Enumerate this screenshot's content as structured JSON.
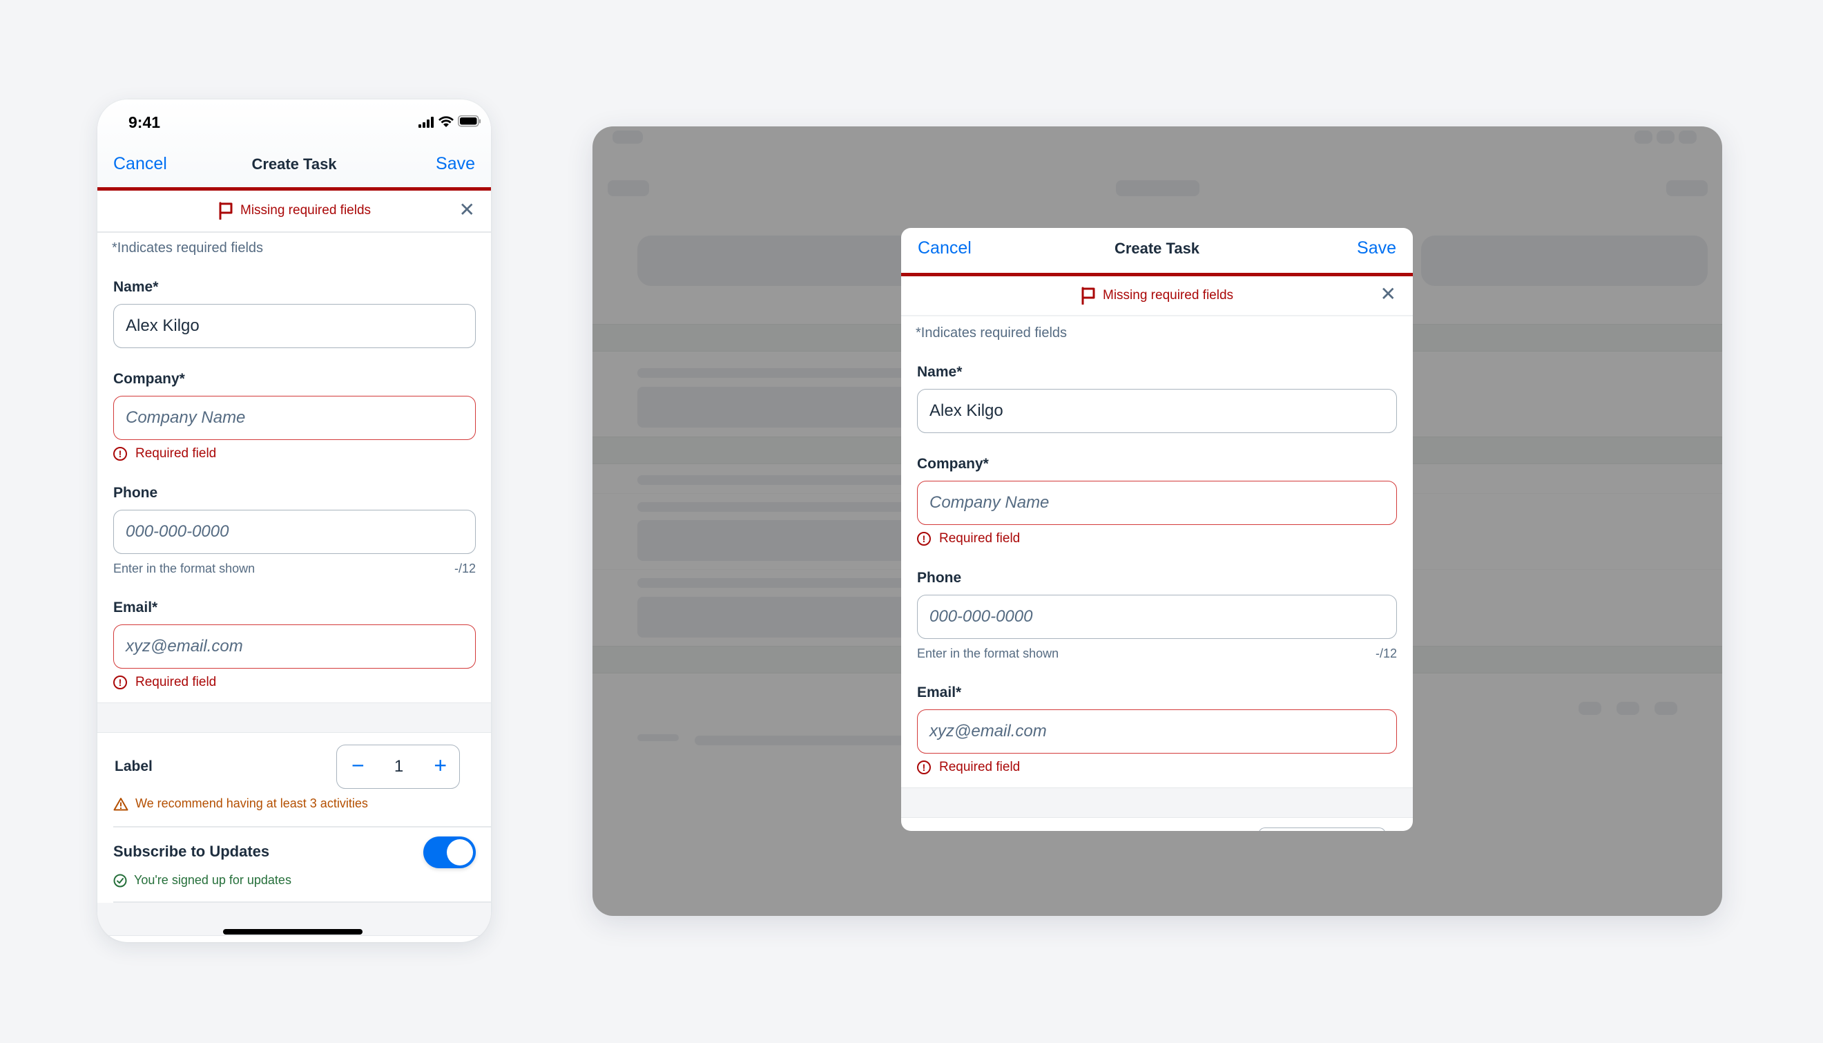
{
  "phone": {
    "status_bar": {
      "time": "9:41",
      "icons": [
        "cellular-signal-icon",
        "wifi-icon",
        "battery-icon"
      ]
    },
    "nav": {
      "cancel_label": "Cancel",
      "title": "Create Task",
      "save_label": "Save"
    },
    "banner": {
      "icon": "flag-icon",
      "message": "Missing required fields",
      "close_icon": "close-icon"
    },
    "required_hint": "*Indicates required fields",
    "fields": {
      "name": {
        "label": "Name*",
        "value": "Alex Kilgo"
      },
      "company": {
        "label": "Company*",
        "placeholder": "Company Name",
        "error": "Required field"
      },
      "phone": {
        "label": "Phone",
        "placeholder": "000-000-0000",
        "helper": "Enter in the format shown",
        "counter": "-/12"
      },
      "email": {
        "label": "Email*",
        "placeholder": "xyz@email.com",
        "error": "Required field"
      }
    },
    "stepper": {
      "label": "Label",
      "value": "1",
      "minus": "−",
      "plus": "+",
      "warning": "We recommend having at least 3 activities"
    },
    "subscribe": {
      "label": "Subscribe to Updates",
      "enabled": true,
      "success": "You're signed up for updates"
    }
  },
  "dialog": {
    "nav": {
      "cancel_label": "Cancel",
      "title": "Create Task",
      "save_label": "Save"
    },
    "banner": {
      "icon": "flag-icon",
      "message": "Missing required fields",
      "close_icon": "close-icon"
    },
    "required_hint": "*Indicates required fields",
    "fields": {
      "name": {
        "label": "Name*",
        "value": "Alex Kilgo"
      },
      "company": {
        "label": "Company*",
        "placeholder": "Company Name",
        "error": "Required field"
      },
      "phone": {
        "label": "Phone",
        "placeholder": "000-000-0000",
        "helper": "Enter in the format shown",
        "counter": "-/12"
      },
      "email": {
        "label": "Email*",
        "placeholder": "xyz@email.com",
        "error": "Required field"
      }
    }
  },
  "colors": {
    "accent": "#0070f2",
    "error": "#aa0808",
    "warning": "#b44f00",
    "success": "#256f3a",
    "text": "#1d2d3e",
    "overlay": "#999999"
  },
  "icons": {
    "close": "✕",
    "error": "!",
    "warning": "⚠",
    "check": "✓"
  }
}
